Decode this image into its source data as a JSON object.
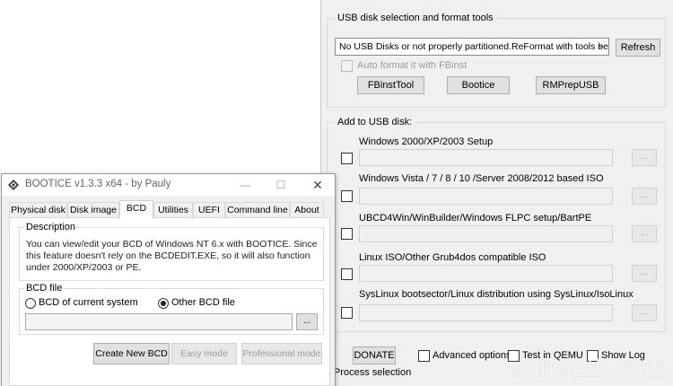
{
  "main_window": {
    "usb_group_title": "USB disk selection and format tools",
    "usb_select_value": "No USB Disks or not properly partitioned.ReFormat with tools below",
    "refresh_label": "Refresh",
    "auto_format_label": "Auto format it with FBinst",
    "tools": [
      "FBinstTool",
      "Bootice",
      "RMPrepUSB"
    ],
    "add_group_title": "Add to USB disk:",
    "sources": [
      {
        "label": "Windows 2000/XP/2003 Setup"
      },
      {
        "label": "Windows Vista / 7 / 8 / 10 /Server 2008/2012 based ISO"
      },
      {
        "label": "UBCD4Win/WinBuilder/Windows FLPC setup/BartPE"
      },
      {
        "label": "Linux ISO/Other Grub4dos compatible ISO"
      },
      {
        "label": "SysLinux bootsector/Linux distribution using SysLinux/IsoLinux"
      }
    ],
    "browse_label": "...",
    "donate_label": "DONATE",
    "advanced_options_label": "Advanced options",
    "test_in_qemu_label": "Test in QEMU",
    "show_log_label": "Show Log",
    "process_selection_label": "Process selection"
  },
  "bootice": {
    "title": "BOOTICE v1.3.3 x64 - by Pauly",
    "tabs": [
      "Physical disk",
      "Disk image",
      "BCD",
      "Utilities",
      "UEFI",
      "Command line",
      "About"
    ],
    "active_tab": "BCD",
    "description_title": "Description",
    "description_text": "You can view/edit your BCD of Windows NT 6.x with BOOTICE. Since this feature doesn't rely on the BCDEDIT.EXE, so it will also function under 2000/XP/2003 or PE.",
    "bcd_file_title": "BCD file",
    "radio_current": "BCD of current system",
    "radio_other": "Other BCD file",
    "browse_label": "...",
    "buttons": {
      "create_new_bcd": "Create New BCD",
      "easy_mode": "Easy mode",
      "professional_mode": "Professional mode"
    }
  },
  "watermark": "softoLib.com"
}
